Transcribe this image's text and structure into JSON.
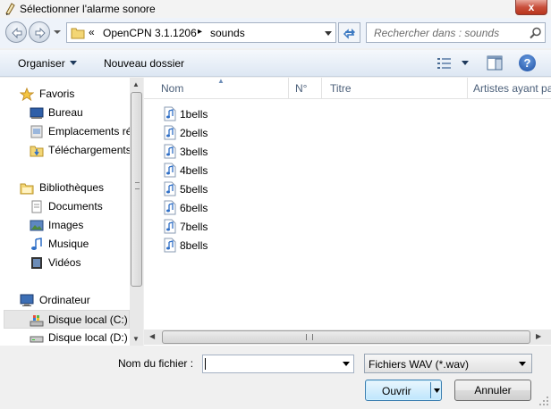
{
  "window": {
    "title": "Sélectionner l'alarme sonore",
    "close_label": "x"
  },
  "address": {
    "overflow": "«",
    "segments": [
      "OpenCPN 3.1.1206",
      "sounds"
    ],
    "separator": "▸"
  },
  "search": {
    "placeholder": "Rechercher dans : sounds"
  },
  "toolbar": {
    "organise_label": "Organiser",
    "new_folder_label": "Nouveau dossier",
    "help_label": "?"
  },
  "navpane": {
    "items": [
      {
        "label": "Favoris",
        "icon": "star-icon"
      },
      {
        "label": "Bureau",
        "icon": "desktop-icon"
      },
      {
        "label": "Emplacements récents",
        "icon": "recent-places-icon"
      },
      {
        "label": "Téléchargements",
        "icon": "downloads-folder-icon"
      },
      {
        "label": "Bibliothèques",
        "icon": "libraries-icon"
      },
      {
        "label": "Documents",
        "icon": "documents-icon"
      },
      {
        "label": "Images",
        "icon": "pictures-icon"
      },
      {
        "label": "Musique",
        "icon": "music-icon"
      },
      {
        "label": "Vidéos",
        "icon": "videos-icon"
      },
      {
        "label": "Ordinateur",
        "icon": "computer-icon"
      },
      {
        "label": "Disque local (C:)",
        "icon": "windows-drive-icon",
        "selected": true
      },
      {
        "label": "Disque local (D:)",
        "icon": "drive-icon"
      }
    ]
  },
  "filelist": {
    "columns": [
      "Nom",
      "N°",
      "Titre",
      "Artistes ayant participé"
    ],
    "files": [
      "1bells",
      "2bells",
      "3bells",
      "4bells",
      "5bells",
      "6bells",
      "7bells",
      "8bells"
    ]
  },
  "bottom": {
    "filename_label": "Nom du fichier :",
    "filename_value": "",
    "filetype": "Fichiers WAV (*.wav)",
    "open_label": "Ouvrir",
    "cancel_label": "Annuler"
  }
}
